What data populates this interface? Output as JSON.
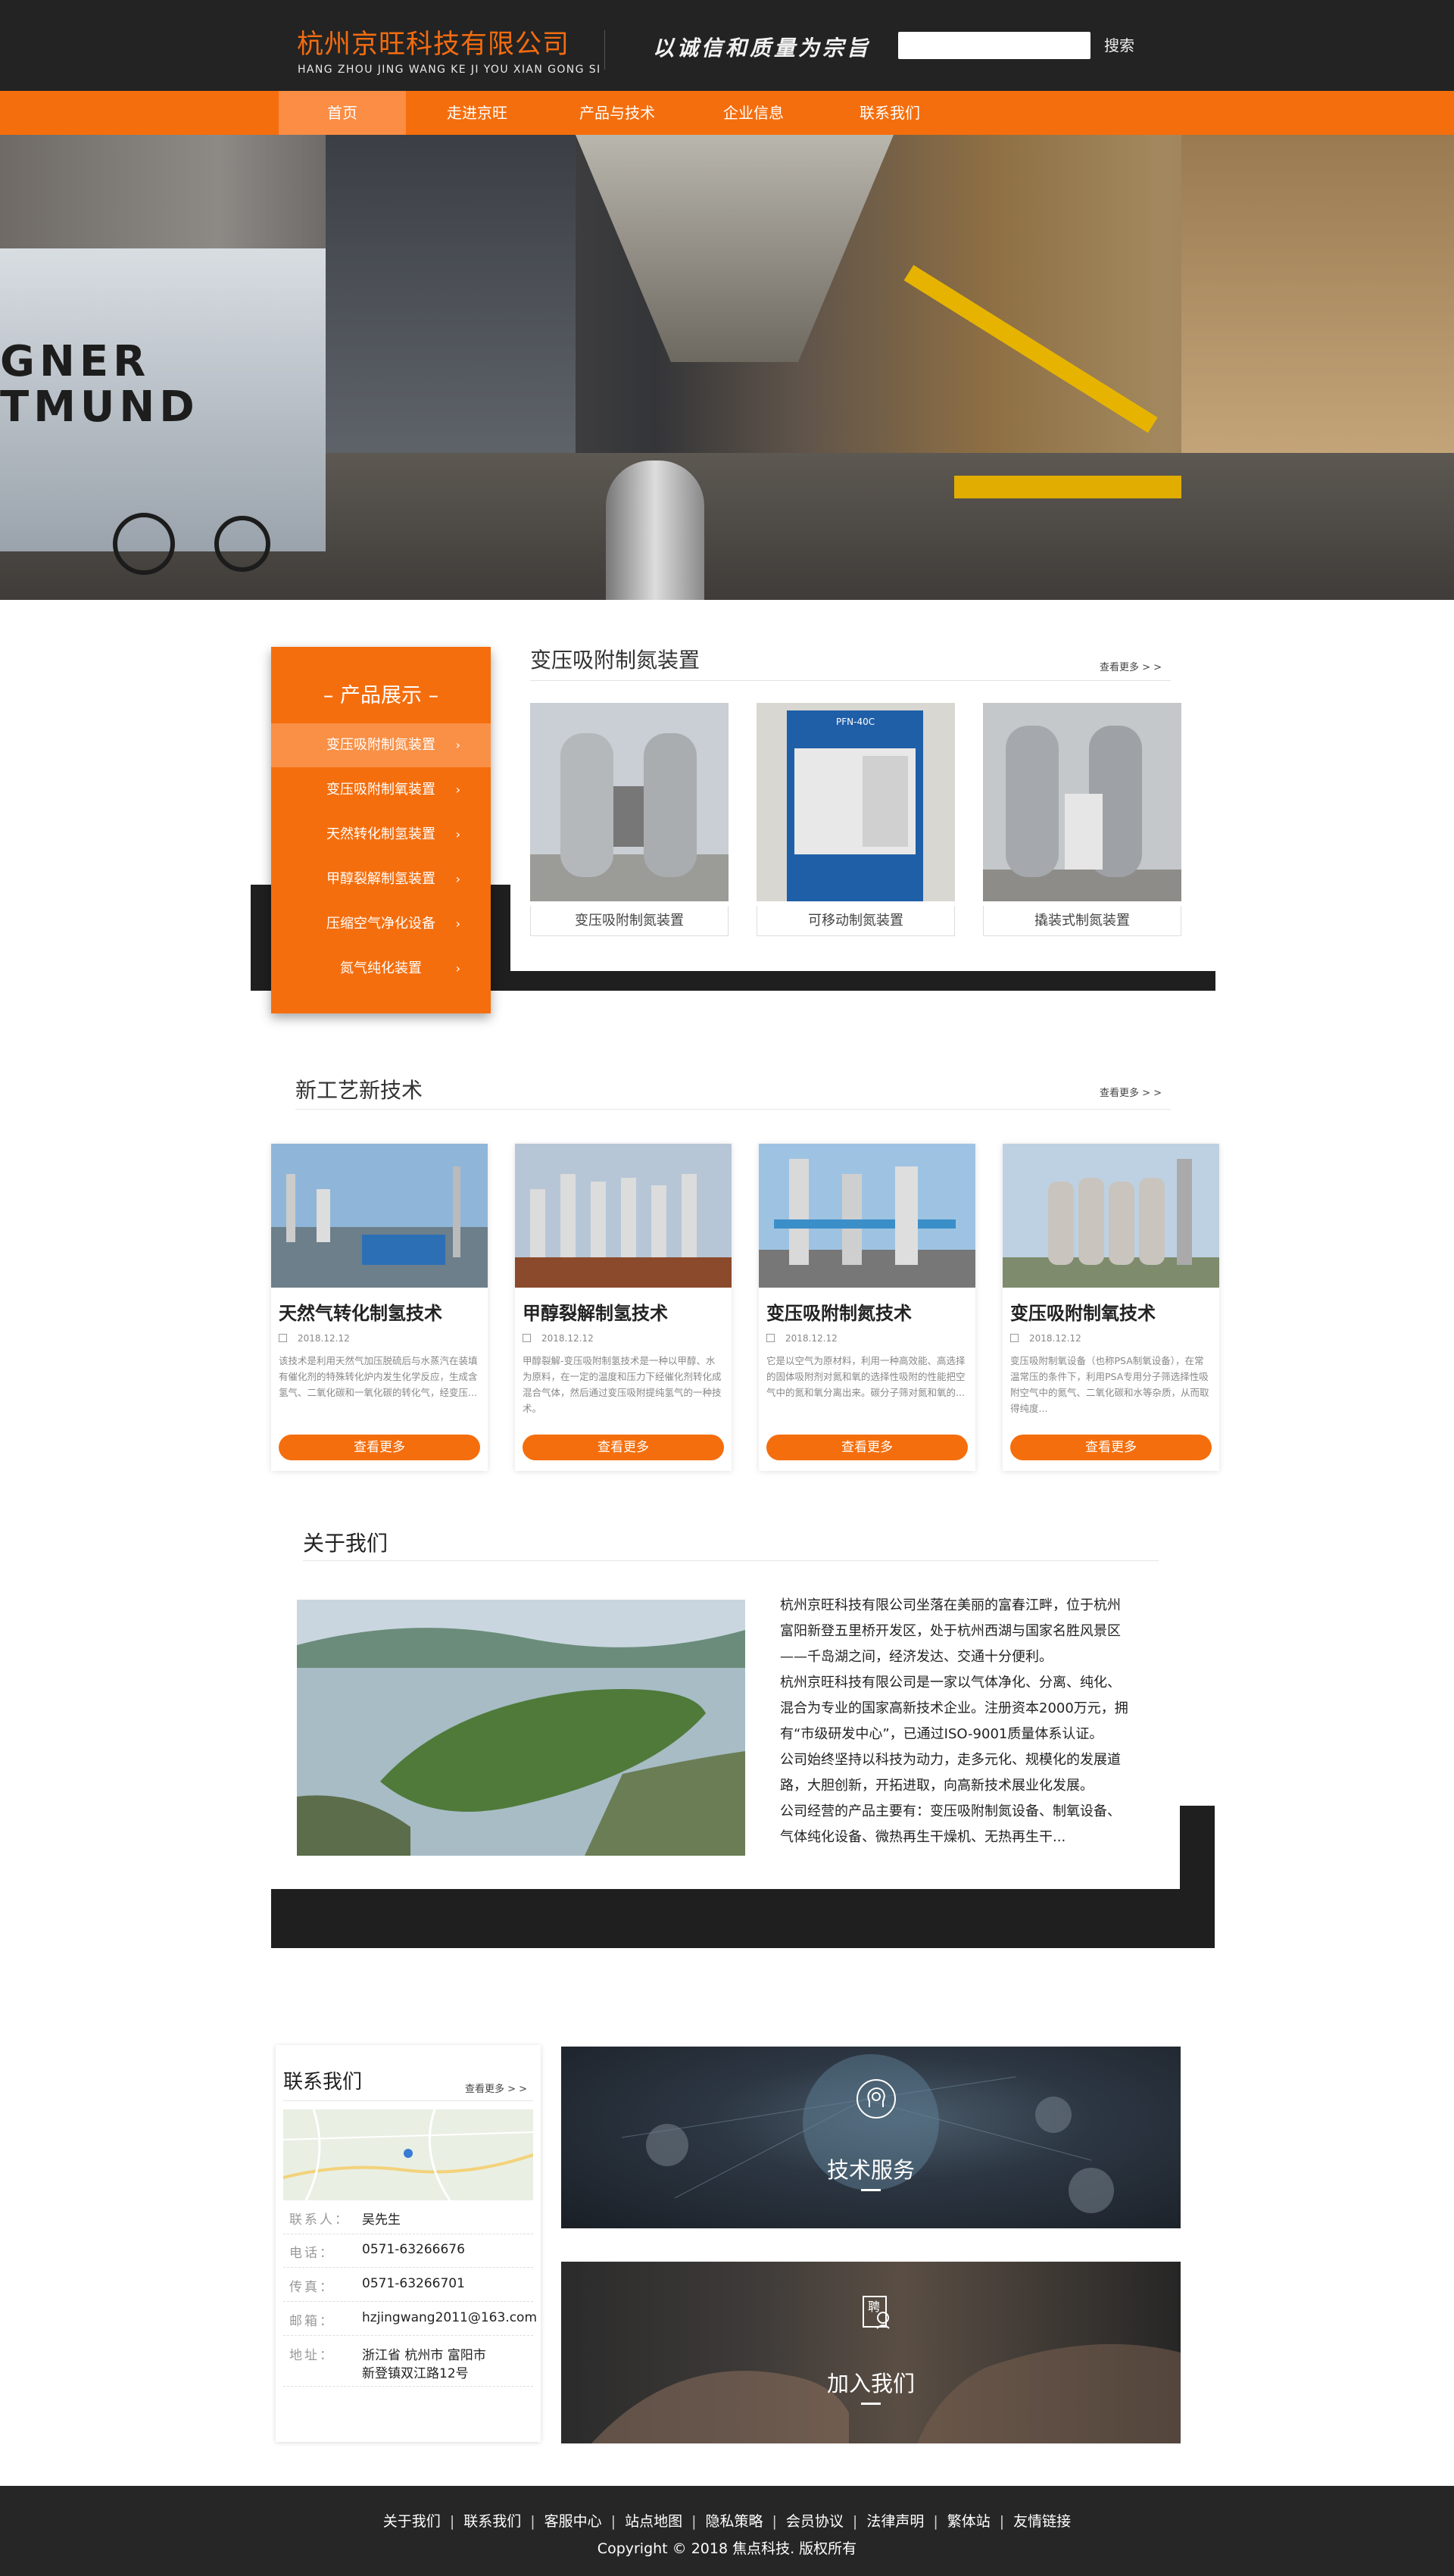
{
  "header": {
    "company_cn": "杭州京旺科技有限公司",
    "company_en": "HANG ZHOU JING WANG KE JI YOU XIAN GONG SI",
    "slogan": "以诚信和质量为宗旨",
    "search_placeholder": "",
    "search_label": "搜索"
  },
  "nav": {
    "items": [
      {
        "label": "首页",
        "active": true
      },
      {
        "label": "走进京旺",
        "active": false
      },
      {
        "label": "产品与技术",
        "active": false
      },
      {
        "label": "企业信息",
        "active": false
      },
      {
        "label": "联系我们",
        "active": false
      }
    ]
  },
  "banner": {
    "slides": 2,
    "active_slide": 1,
    "machine_text": "GNER\nTMUND"
  },
  "products": {
    "menu_title": "– 产品展示 –",
    "menu": [
      {
        "label": "变压吸附制氮装置",
        "active": true
      },
      {
        "label": "变压吸附制氧装置",
        "active": false
      },
      {
        "label": "天然转化制氢装置",
        "active": false
      },
      {
        "label": "甲醇裂解制氢装置",
        "active": false
      },
      {
        "label": "压缩空气净化设备",
        "active": false
      },
      {
        "label": "氮气纯化装置",
        "active": false
      }
    ],
    "section_title": "变压吸附制氮装置",
    "more_label": "查看更多 > >",
    "items": [
      {
        "caption": "变压吸附制氮装置"
      },
      {
        "caption": "可移动制氮装置",
        "panel_label": "PFN-40C"
      },
      {
        "caption": "撬装式制氮装置"
      }
    ]
  },
  "tech": {
    "title": "新工艺新技术",
    "more_label": "查看更多 > >",
    "button_label": "查看更多",
    "items": [
      {
        "name": "天然气转化制氢技术",
        "date": "2018.12.12",
        "desc": "该技术是利用天然气加压脱硫后与水蒸汽在装填有催化剂的特殊转化炉内发生化学反应，生成含氢气、二氧化碳和一氧化碳的转化气，经变压..."
      },
      {
        "name": "甲醇裂解制氢技术",
        "date": "2018.12.12",
        "desc": "甲醇裂解-变压吸附制氢技术是一种以甲醇、水为原料，在一定的温度和压力下经催化剂转化成混合气体，然后通过变压吸附提纯氢气的一种技术。"
      },
      {
        "name": "变压吸附制氮技术",
        "date": "2018.12.12",
        "desc": "它是以空气为原材料，利用一种高效能、高选择的固体吸附剂对氮和氧的选择性吸附的性能把空气中的氮和氧分离出来。碳分子筛对氮和氧的..."
      },
      {
        "name": "变压吸附制氧技术",
        "date": "2018.12.12",
        "desc": "变压吸附制氧设备（也称PSA制氧设备），在常温常压的条件下，利用PSA专用分子筛选择性吸附空气中的氮气、二氧化碳和水等杂质，从而取得纯度..."
      }
    ]
  },
  "about": {
    "title": "关于我们",
    "paragraphs": [
      "杭州京旺科技有限公司坐落在美丽的富春江畔，位于杭州",
      "富阳新登五里桥开发区，处于杭州西湖与国家名胜风景区",
      "——千岛湖之间，经济发达、交通十分便利。",
      "杭州京旺科技有限公司是一家以气体净化、分离、纯化、",
      "混合为专业的国家高新技术企业。注册资本2000万元，拥",
      "有“市级研发中心”，已通过ISO-9001质量体系认证。",
      "公司始终坚持以科技为动力，走多元化、规模化的发展道",
      "路，大胆创新，开拓进取，向高新技术展业化发展。",
      "公司经营的产品主要有：变压吸附制氮设备、制氧设备、",
      "气体纯化设备、微热再生干燥机、无热再生干..."
    ]
  },
  "contact": {
    "title": "联系我们",
    "more_label": "查看更多 > >",
    "rows": [
      {
        "label": "联系人：",
        "value": "吴先生"
      },
      {
        "label": "电话：",
        "value": "0571-63266676"
      },
      {
        "label": "传真：",
        "value": "0571-63266701"
      },
      {
        "label": "邮箱：",
        "value": "hzjingwang2011@163.com"
      },
      {
        "label": "地址：",
        "value": "浙江省 杭州市 富阳市",
        "value2": "新登镇双江路12号"
      }
    ]
  },
  "services": {
    "tech_service": "技术服务",
    "join_us": "加入我们",
    "join_icon_char": "聘"
  },
  "footer": {
    "links": [
      "关于我们",
      "联系我们",
      "客服中心",
      "站点地图",
      "隐私策略",
      "会员协议",
      "法律声明",
      "繁体站",
      "友情链接"
    ],
    "copyright": "Copyright © 2018 焦点科技. 版权所有"
  },
  "colors": {
    "accent": "#f56e0d",
    "dark": "#232323"
  }
}
